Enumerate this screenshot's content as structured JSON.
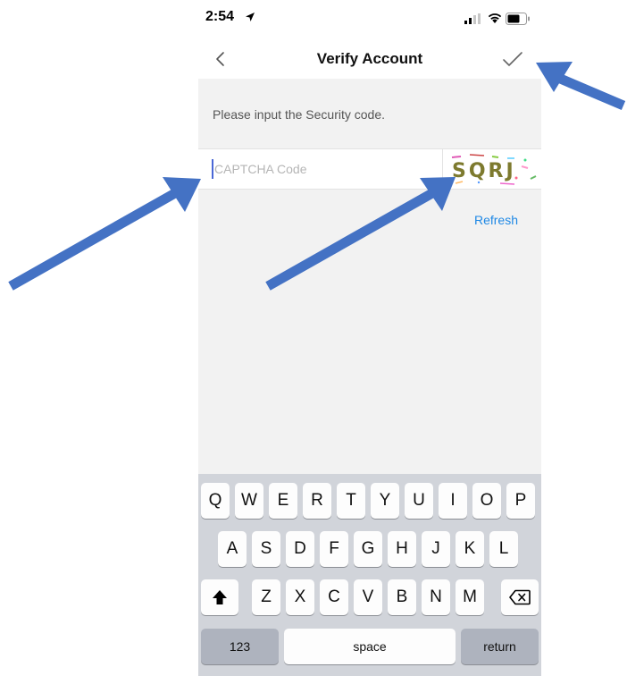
{
  "status": {
    "time": "2:54"
  },
  "nav": {
    "title": "Verify Account"
  },
  "instruction": "Please input the Security code.",
  "captcha": {
    "placeholder": "CAPTCHA Code",
    "image_text": "SQRJ"
  },
  "refresh_label": "Refresh",
  "keyboard": {
    "row1": [
      "Q",
      "W",
      "E",
      "R",
      "T",
      "Y",
      "U",
      "I",
      "O",
      "P"
    ],
    "row2": [
      "A",
      "S",
      "D",
      "F",
      "G",
      "H",
      "J",
      "K",
      "L"
    ],
    "row3": [
      "Z",
      "X",
      "C",
      "V",
      "B",
      "N",
      "M"
    ],
    "numbers_label": "123",
    "space_label": "space",
    "return_label": "return"
  },
  "icons": {
    "back": "chevron-left-icon",
    "confirm": "checkmark-icon",
    "shift": "shift-icon",
    "delete": "backspace-icon",
    "location": "location-arrow-icon",
    "signal": "signal-icon",
    "wifi": "wifi-icon",
    "battery": "battery-icon"
  },
  "colors": {
    "accent": "#1e88e5",
    "annotation_arrow": "#4472c4",
    "keyboard_bg": "#d1d4da"
  }
}
